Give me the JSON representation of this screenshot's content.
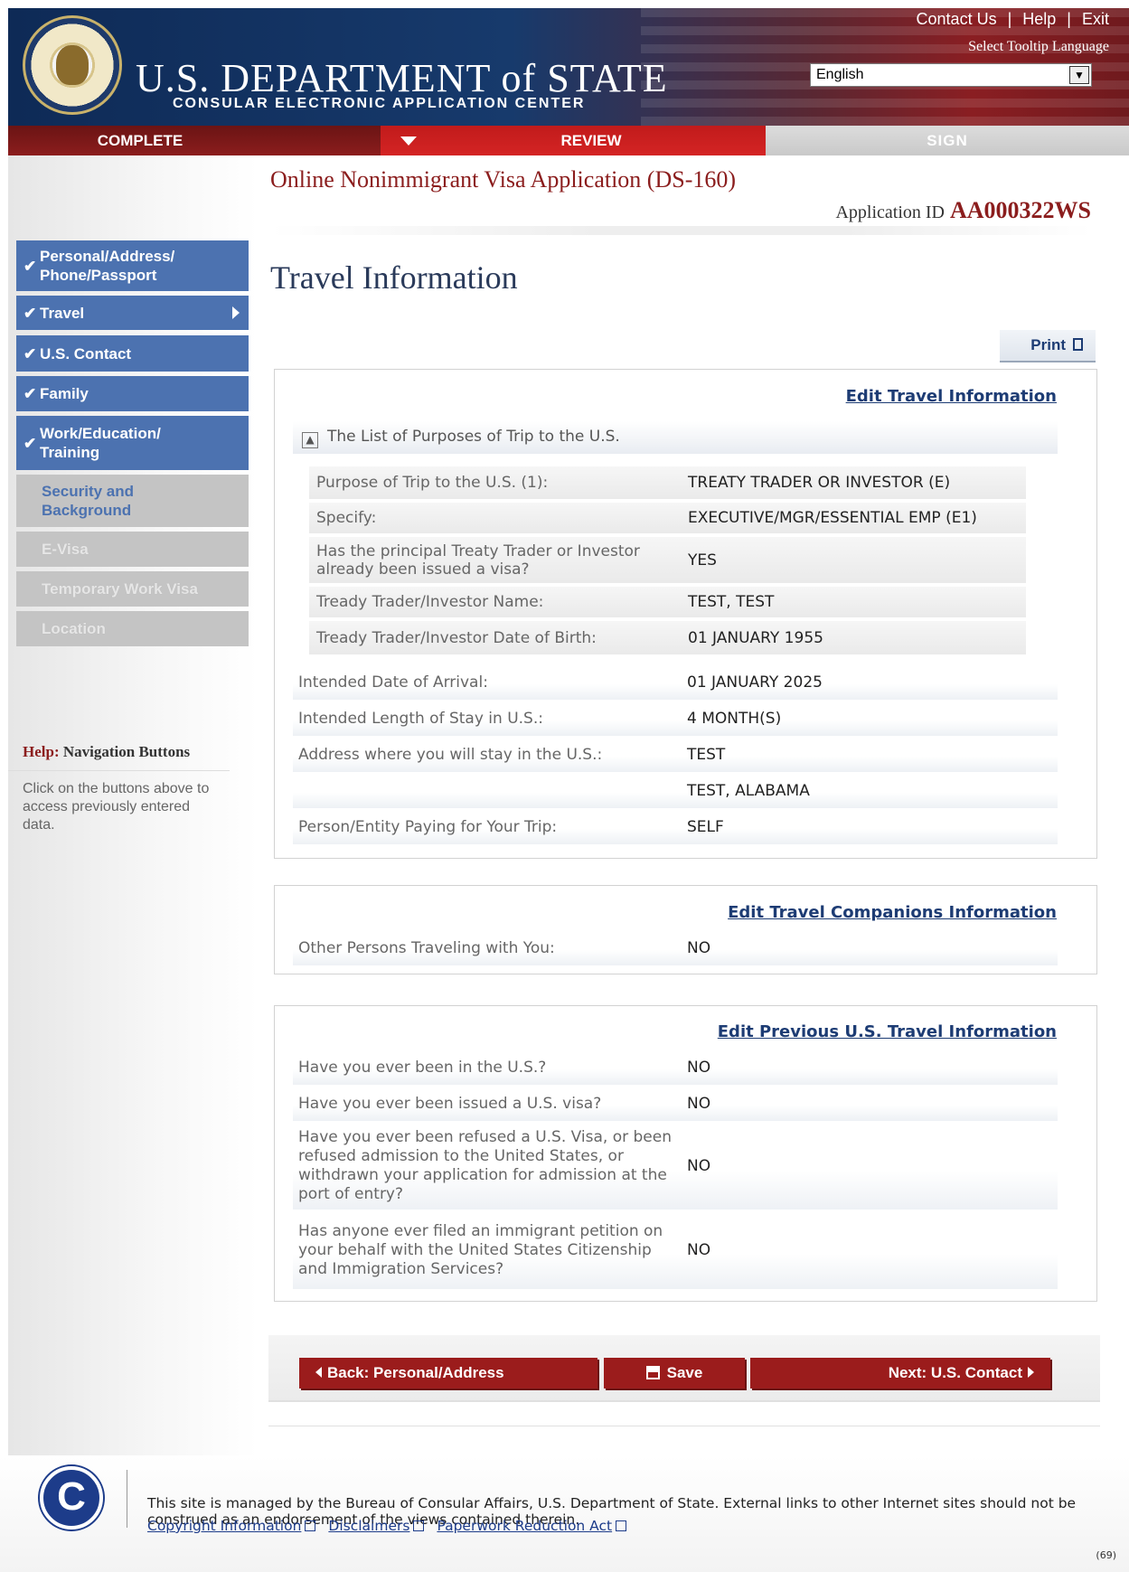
{
  "header": {
    "dept_title": "U.S. DEPARTMENT of STATE",
    "dept_subtitle": "CONSULAR ELECTRONIC APPLICATION CENTER",
    "links": {
      "contact": "Contact Us",
      "help": "Help",
      "exit": "Exit"
    },
    "tooltip_label": "Select Tooltip Language",
    "language_selected": "English",
    "colors": {
      "navy": "#0e2a56",
      "red": "#8a1e22"
    }
  },
  "progress": {
    "complete": "COMPLETE",
    "review": "REVIEW",
    "sign": "SIGN",
    "current": "REVIEW",
    "colors": {
      "complete": "#8b1d1d",
      "review": "#d42424",
      "sign": "#c9c9c9"
    }
  },
  "sidebar": {
    "items": [
      {
        "label": "Personal/Address/ Phone/Passport",
        "status": "done"
      },
      {
        "label": "Travel",
        "status": "done",
        "current": true
      },
      {
        "label": "U.S. Contact",
        "status": "done"
      },
      {
        "label": "Family",
        "status": "done"
      },
      {
        "label": "Work/Education/ Training",
        "status": "done"
      },
      {
        "label": "Security and Background",
        "status": "todo"
      },
      {
        "label": "E-Visa",
        "status": "disabled"
      },
      {
        "label": "Temporary Work Visa",
        "status": "disabled"
      },
      {
        "label": "Location",
        "status": "disabled"
      }
    ],
    "help": {
      "title_prefix": "Help:",
      "title": "Navigation Buttons",
      "text": "Click on the buttons above to access previously entered data."
    }
  },
  "main": {
    "app_title": "Online Nonimmigrant Visa Application (DS-160)",
    "app_id_label": "Application ID",
    "app_id": "AA000322WS",
    "page_title": "Travel Information",
    "print_label": "Print",
    "travel": {
      "edit_label": "Edit Travel Information",
      "purposes_header": "The List of Purposes of Trip to the U.S.",
      "purpose_rows": [
        {
          "q": "Purpose of Trip to the U.S. (1):",
          "a": "TREATY TRADER OR INVESTOR (E)"
        },
        {
          "q": "Specify:",
          "a": "EXECUTIVE/MGR/ESSENTIAL EMP (E1)"
        },
        {
          "q": "Has the principal Treaty Trader or Investor already been issued a visa?",
          "a": "YES"
        },
        {
          "q": "Tready Trader/Investor Name:",
          "a": "TEST, TEST"
        },
        {
          "q": "Tready Trader/Investor Date of Birth:",
          "a": "01 JANUARY 1955"
        }
      ],
      "rows": [
        {
          "q": "Intended Date of Arrival:",
          "a": "01 JANUARY 2025"
        },
        {
          "q": "Intended Length of Stay in U.S.:",
          "a": "4 MONTH(S)"
        },
        {
          "q": "Address where you will stay in the U.S.:",
          "a": "TEST"
        },
        {
          "q": "",
          "a": "TEST, ALABAMA"
        },
        {
          "q": "Person/Entity Paying for Your Trip:",
          "a": "SELF"
        }
      ]
    },
    "companions": {
      "edit_label": "Edit Travel Companions Information",
      "rows": [
        {
          "q": "Other Persons Traveling with You:",
          "a": "NO"
        }
      ]
    },
    "previous": {
      "edit_label": "Edit Previous U.S. Travel Information",
      "rows": [
        {
          "q": "Have you ever been in the U.S.?",
          "a": "NO"
        },
        {
          "q": "Have you ever been issued a U.S. visa?",
          "a": "NO"
        },
        {
          "q": "Have you ever been refused a U.S. Visa, or been refused admission to the United States, or withdrawn your application for admission at the port of entry?",
          "a": "NO"
        },
        {
          "q": "Has anyone ever filed an immigrant petition on your behalf with the United States Citizenship and Immigration Services?",
          "a": "NO"
        }
      ]
    },
    "buttons": {
      "back": "Back: Personal/Address",
      "save": "Save",
      "next": "Next: U.S. Contact"
    }
  },
  "footer": {
    "logo_letter": "C",
    "text": "This site is managed by the Bureau of Consular Affairs, U.S. Department of State. External links to other Internet sites should not be construed as an endorsement of the views contained therein.",
    "links": [
      "Copyright Information",
      "Disclaimers",
      "Paperwork Reduction Act"
    ],
    "page_count": "(69)"
  }
}
